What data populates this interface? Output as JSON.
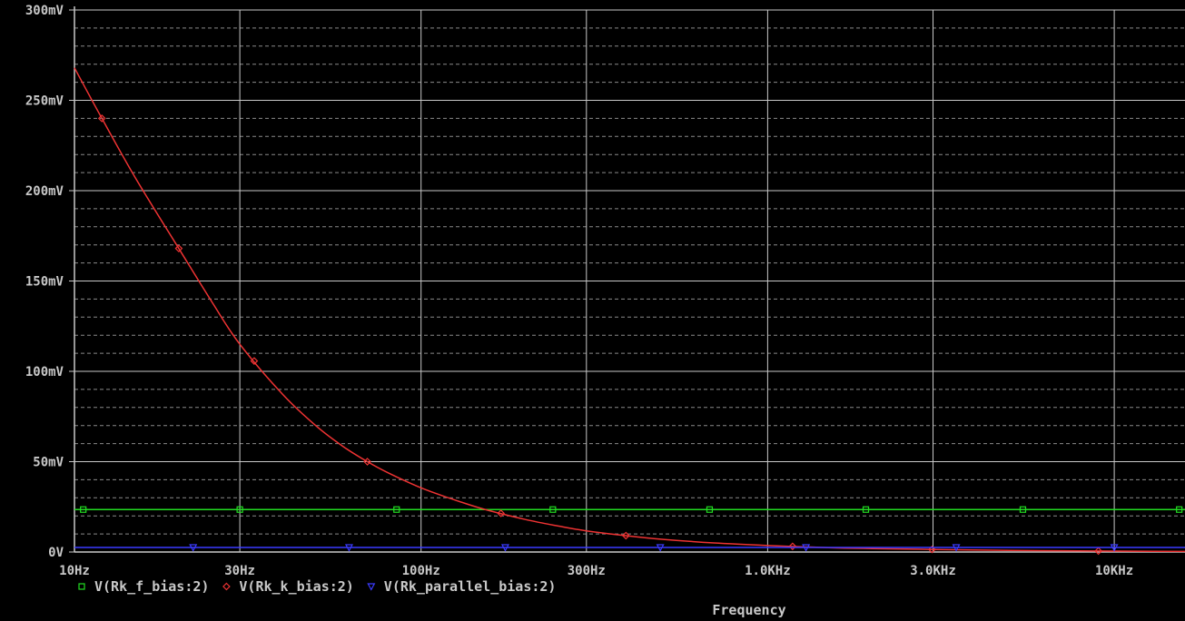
{
  "colors": {
    "background": "#000000",
    "grid_major": "#c8c8c8",
    "grid_minor": "#8a8a8a",
    "text": "#c8c8c8",
    "series_f": "#22dd22",
    "series_k": "#ee3333",
    "series_parallel": "#3b3bff"
  },
  "chart_data": {
    "type": "line",
    "xscale": "log",
    "xlim": [
      10,
      16000
    ],
    "ylim": [
      0,
      300
    ],
    "yunit": "mV",
    "xlabel": "Frequency",
    "ylabel": "",
    "grid": true,
    "legend_position": "bottom-left",
    "x_ticks": [
      {
        "value": 10,
        "label": "10Hz"
      },
      {
        "value": 30,
        "label": "30Hz"
      },
      {
        "value": 100,
        "label": "100Hz"
      },
      {
        "value": 300,
        "label": "300Hz"
      },
      {
        "value": 1000,
        "label": "1.0KHz"
      },
      {
        "value": 3000,
        "label": "3.0KHz"
      },
      {
        "value": 10000,
        "label": "10KHz"
      }
    ],
    "y_ticks": [
      {
        "value": 0,
        "label": "0V"
      },
      {
        "value": 50,
        "label": "50mV"
      },
      {
        "value": 100,
        "label": "100mV"
      },
      {
        "value": 150,
        "label": "150mV"
      },
      {
        "value": 200,
        "label": "200mV"
      },
      {
        "value": 250,
        "label": "250mV"
      },
      {
        "value": 300,
        "label": "300mV"
      }
    ],
    "series": [
      {
        "name": "V(Rk_f_bias:2)",
        "marker": "square",
        "color_key": "series_f",
        "x": [
          10,
          16000
        ],
        "y": [
          23.5,
          23.5
        ],
        "marker_x": [
          10.6,
          30,
          85,
          240,
          680,
          1920,
          5450,
          15400
        ]
      },
      {
        "name": "V(Rk_k_bias:2)",
        "marker": "diamond",
        "color_key": "series_k",
        "x": [
          10,
          12,
          15,
          20,
          25,
          30,
          40,
          50,
          60,
          70,
          80,
          100,
          120,
          150,
          200,
          250,
          300,
          400,
          500,
          700,
          1000,
          1500,
          2000,
          3000,
          5000,
          10000,
          16000
        ],
        "y": [
          268,
          240,
          207,
          168,
          138,
          115,
          87,
          69.5,
          58,
          50,
          44,
          35.5,
          30,
          24,
          18,
          14.3,
          11.7,
          8.8,
          7,
          5,
          3.6,
          2.4,
          1.9,
          1.4,
          0.9,
          0.5,
          0.3
        ],
        "marker_x": [
          12,
          20,
          33,
          70,
          170,
          390,
          1180,
          2980,
          9000
        ]
      },
      {
        "name": "V(Rk_parallel_bias:2)",
        "marker": "triangle",
        "color_key": "series_parallel",
        "x": [
          10,
          16000
        ],
        "y": [
          2.5,
          2.5
        ],
        "marker_x": [
          22,
          62,
          175,
          490,
          1290,
          3500,
          10000
        ]
      }
    ]
  }
}
